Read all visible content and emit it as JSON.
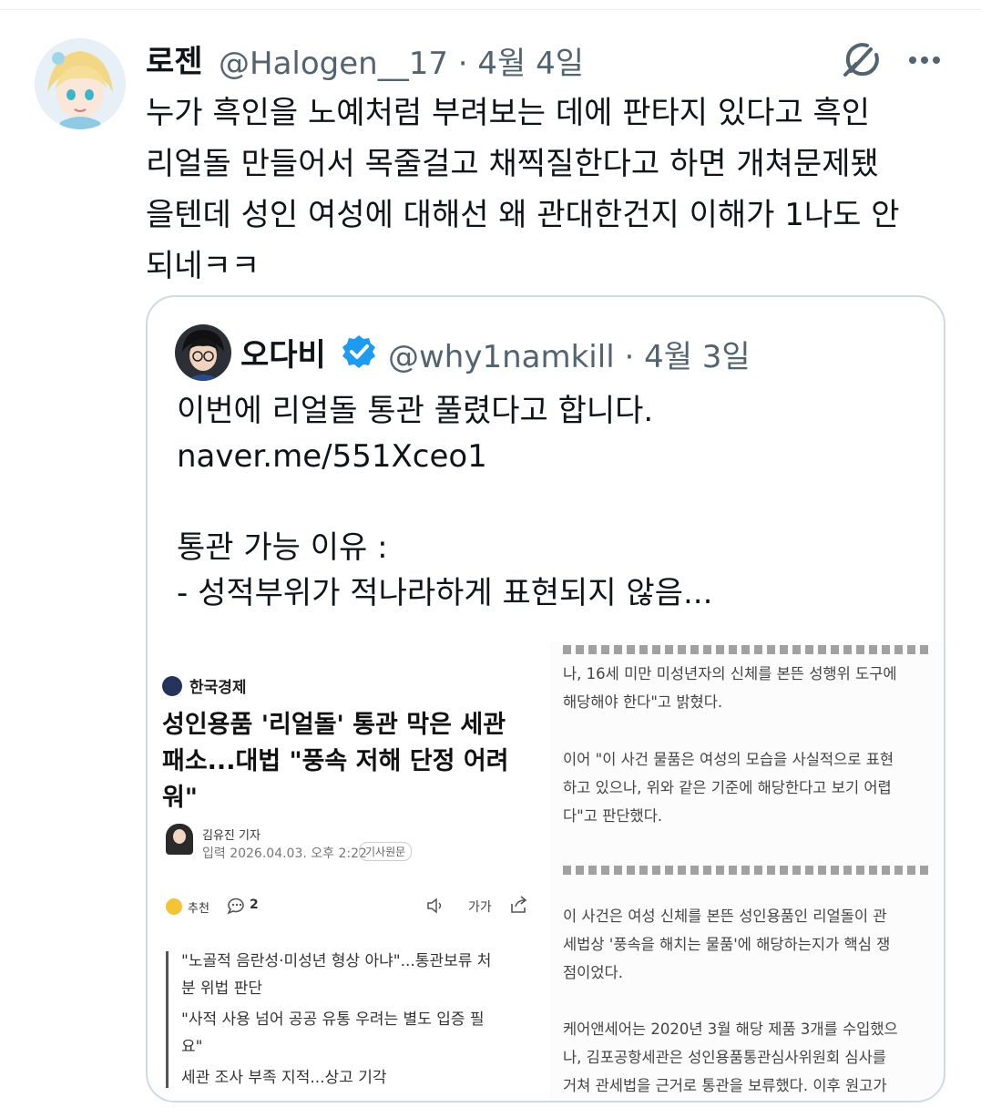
{
  "tweet": {
    "author_name": "로젠",
    "handle_date": "@Halogen__17 · 4월 4일",
    "text": "누가 흑인을 노예처럼 부려보는 데에 판타지 있다고 흑인\n리얼돌 만들어서 목줄걸고 채찍질한다고 하면 개쳐문제됐\n을텐데 성인 여성에 대해선 왜 관대한건지 이해가 1나도 안\n되네ㅋㅋ",
    "icons": {
      "grok": "grok-icon",
      "more": "more-icon"
    }
  },
  "quote": {
    "author_name": "오다비",
    "verified": "verified-badge-icon",
    "handle_date": "@why1namkill · 4월 3일",
    "text": "이번에 리얼돌 통관 풀렸다고 합니다.\nnaver.me/551Xceo1\n\n통관 가능 이유 :\n- 성적부위가 적나라하게 표현되지 않음...",
    "article": {
      "publisher": "한국경제",
      "headline": "성인용품 '리얼돌' 통관 막은 세관\n패소...대법 \"풍속 저해 단정 어려\n워\"",
      "reporter": "김유진 기자",
      "dateline": "입력 2026.04.03. 오후 2:22",
      "original_label": "기사원문",
      "recommend_label": "추천",
      "comment_count": "2",
      "font_size_label": "가가",
      "summary": [
        "\"노골적 음란성·미성년 형상 아냐\"...통관보류 처\n분 위법 판단",
        "\"사적 사용 넘어 공공 유통 우려는 별도 입증 필\n요\"",
        "세관 조사 부족 지적...상고 기각"
      ],
      "right_paragraphs": [
        "나, 16세 미만 미성년자의 신체를 본뜬 성행위 도구에\n해당해야 한다\"고 밝혔다.",
        "이어 \"이 사건 물품은 여성의 모습을 사실적으로 표현\n하고 있으나, 위와 같은 기준에 해당한다고 보기 어렵\n다\"고 판단했다.",
        "이 사건은 여성 신체를 본뜬 성인용품인 리얼돌이 관\n세법상 '풍속을 해치는 물품'에 해당하는지가 핵심 쟁\n점이었다.",
        "케어앤세어는 2020년 3월 해당 제품 3개를 수입했으\n나, 김포공항세관은 성인용품통관심사위원회 심사를\n거쳐 관세법을 근거로 통관을 보류했다. 이후 원고가"
      ]
    }
  },
  "colors": {
    "verified": "#1d9bf0",
    "secondary_text": "#536471",
    "border": "#cfd9de"
  }
}
